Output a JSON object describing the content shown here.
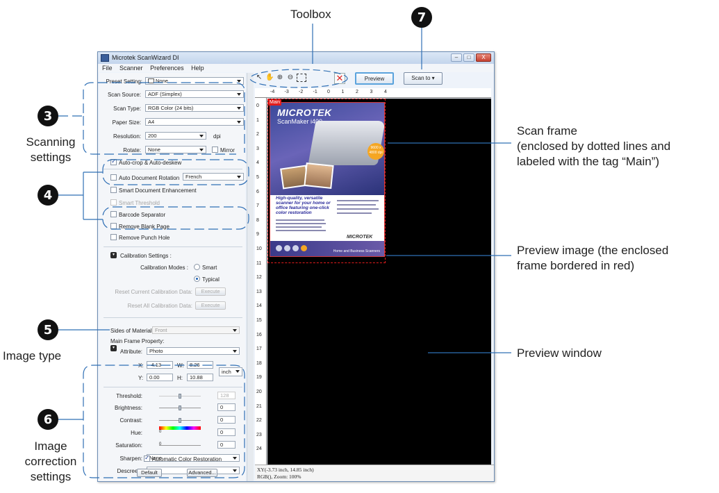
{
  "annotations": {
    "toolbox": "Toolbox",
    "badge3": "3",
    "badge4": "4",
    "badge5": "5",
    "badge6": "6",
    "badge7": "7",
    "scanning_settings_line1": "Scanning",
    "scanning_settings_line2": "settings",
    "image_type": "Image type",
    "image_correction_line1": "Image",
    "image_correction_line2": "correction",
    "image_correction_line3": "settings",
    "scan_frame_line1": "Scan frame",
    "scan_frame_line2": "(enclosed by dotted lines and",
    "scan_frame_line3": "labeled with the tag “Main”)",
    "preview_image_line1": "Preview image (the enclosed",
    "preview_image_line2": "frame bordered in red)",
    "preview_window": "Preview window"
  },
  "window": {
    "title": "Microtek ScanWizard DI",
    "menus": [
      "File",
      "Scanner",
      "Preferences",
      "Help"
    ],
    "controls": {
      "minimize": "–",
      "maximize": "□",
      "close": "X"
    }
  },
  "panel": {
    "preset_label": "Preset Setting:",
    "preset_value": "None",
    "scan_source_label": "Scan Source:",
    "scan_source_value": "ADF (Simplex)",
    "scan_type_label": "Scan Type:",
    "scan_type_value": "RGB Color (24 bits)",
    "paper_size_label": "Paper Size:",
    "paper_size_value": "A4",
    "resolution_label": "Resolution:",
    "resolution_value": "200",
    "resolution_unit": "dpi",
    "rotate_label": "Rotate:",
    "rotate_value": "None",
    "mirror_label": "Mirror",
    "autocrop_label": "Auto-crop & Auto-deskew",
    "auto_doc_rotation_label": "Auto Document Rotation",
    "auto_doc_rotation_lang": "French",
    "smart_doc_enh_label": "Smart Document Enhancement",
    "smart_threshold_label": "Smart Threshold",
    "barcode_label": "Barcode Separator",
    "remove_blank_label": "Remove Blank Page",
    "remove_punch_label": "Remove Punch Hole",
    "calibration_title": "Calibration Settings :",
    "calibration_modes_label": "Calibration Modes :",
    "calibration_smart": "Smart",
    "calibration_typical": "Typical",
    "reset_current_label": "Reset Current Calibration Data:",
    "reset_all_label": "Reset All Calibration Data:",
    "execute": "Execute",
    "sides_label": "Sides of Material:",
    "sides_value": "Front",
    "main_frame_label": "Main Frame Property:",
    "attribute_label": "Attribute:",
    "attribute_value": "Photo",
    "x_label": "X:",
    "x_value": "-4.13",
    "w_label": "W:",
    "w_value": "8.26",
    "y_label": "Y:",
    "y_value": "0.00",
    "h_label": "H:",
    "h_value": "10.88",
    "unit_value": "inch",
    "threshold_label": "Threshold:",
    "threshold_value": "128",
    "brightness_label": "Brightness:",
    "brightness_value": "0",
    "contrast_label": "Contrast:",
    "contrast_value": "0",
    "hue_label": "Hue:",
    "hue_value": "0",
    "hue_zero": "0",
    "saturation_label": "Saturation:",
    "saturation_value": "0",
    "saturation_zero": "0",
    "sharpen_label": "Sharpen:",
    "sharpen_value": "None",
    "descreen_label": "Descreen:",
    "descreen_value": "None",
    "auto_color_label": "Automatic Color Restoration",
    "default_btn": "Default",
    "advanced_btn": "Advanced..."
  },
  "toolbar": {
    "preview_btn": "Preview",
    "scan_to_btn": "Scan to",
    "stop_icon": "✕"
  },
  "ruler": {
    "h_labels": [
      "-4",
      "-3",
      "-2",
      "-1",
      "0",
      "1",
      "2",
      "3",
      "4"
    ],
    "v_labels": [
      "0",
      "1",
      "2",
      "3",
      "4",
      "5",
      "6",
      "7",
      "8",
      "9",
      "10",
      "11",
      "12",
      "13",
      "14",
      "15",
      "16",
      "17",
      "18",
      "19",
      "20",
      "21",
      "22",
      "23",
      "24"
    ]
  },
  "preview": {
    "frame_tag": "Main",
    "brochure_logo": "MICROTEK",
    "brochure_model": "ScanMaker i400",
    "brochure_headline": "High-quality, versatile scanner for your home or office featuring one-click color restoration",
    "brochure_mini_logo": "MICROTEK",
    "brochure_footer": "Home and Business Scanners",
    "dpi_badge": "9600 x 4800 dpi"
  },
  "status": {
    "line1": "XY(-3.73 inch, 14.85 inch)",
    "line2": "RGB(), Zoom: 100%"
  },
  "colors": {
    "callout_blue": "#2f6fb5",
    "scan_frame_red": "#e21c1c",
    "preview_bg": "#000000"
  }
}
